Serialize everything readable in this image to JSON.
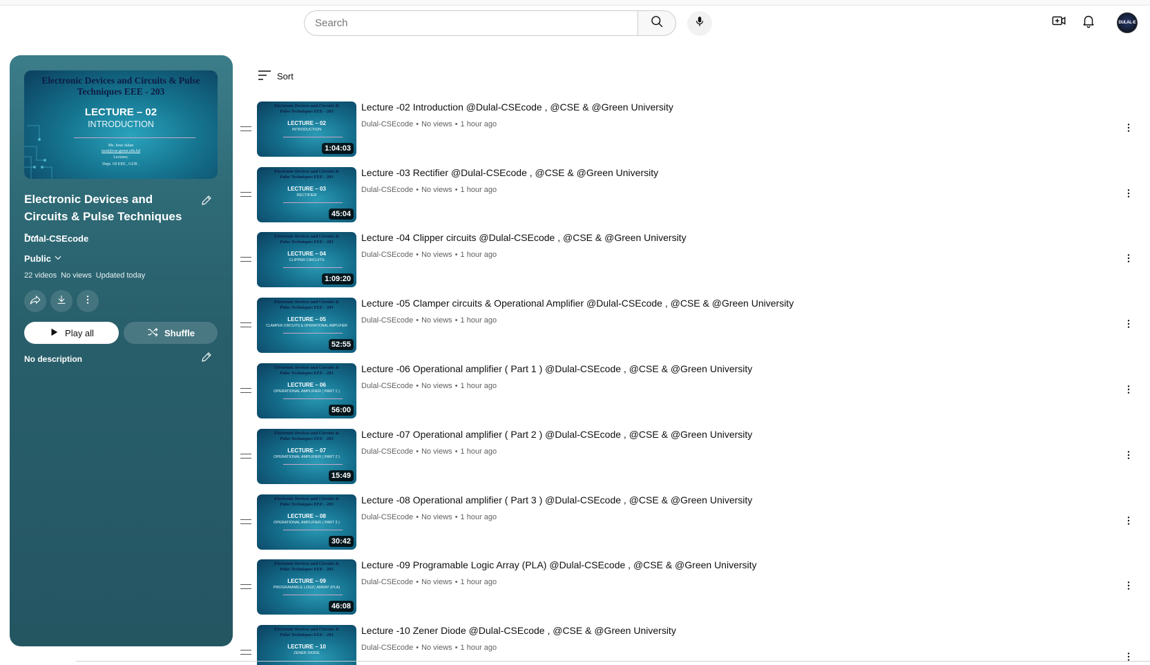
{
  "header": {
    "search_placeholder": "Search",
    "avatar_text": "DULAL-E"
  },
  "playlist": {
    "thumb": {
      "title": "Electronic Devices and Circuits & Pulse Techniques EEE - 203",
      "lecture": "LECTURE – 02",
      "subtitle": "INTRODUCTION",
      "name": "Ms. Israt Jahan",
      "email": "israt@cse.green.edu.bd",
      "role": "Lecturer,",
      "dept": "Dept. Of EEE , GUB ."
    },
    "title": "Electronic Devices and Circuits & Pulse Techniques -...",
    "owner": "Dulal-CSEcode",
    "privacy": "Public",
    "video_count": "22 videos",
    "views": "No views",
    "updated": "Updated today",
    "play_all_label": "Play all",
    "shuffle_label": "Shuffle",
    "description": "No description"
  },
  "sort_label": "Sort",
  "videos": [
    {
      "title": "Lecture -02 Introduction @Dulal-CSEcode , @CSE & @Green University",
      "channel": "Dulal-CSEcode",
      "views": "No views",
      "age": "1 hour ago",
      "duration": "1:04:03",
      "thumb_lecture": "LECTURE – 02",
      "thumb_sub": "INTRODUCTION"
    },
    {
      "title": "Lecture -03 Rectifier @Dulal-CSEcode , @CSE & @Green University",
      "channel": "Dulal-CSEcode",
      "views": "No views",
      "age": "1 hour ago",
      "duration": "45:04",
      "thumb_lecture": "LECTURE – 03",
      "thumb_sub": "RECTIFIER"
    },
    {
      "title": "Lecture -04 Clipper circuits @Dulal-CSEcode , @CSE & @Green University",
      "channel": "Dulal-CSEcode",
      "views": "No views",
      "age": "1 hour ago",
      "duration": "1:09:20",
      "thumb_lecture": "LECTURE – 04",
      "thumb_sub": "CLIPPER CIRCUITS"
    },
    {
      "title": "Lecture -05 Clamper circuits & Operational Amplifier @Dulal-CSEcode , @CSE & @Green University",
      "channel": "Dulal-CSEcode",
      "views": "No views",
      "age": "1 hour ago",
      "duration": "52:55",
      "thumb_lecture": "LECTURE – 05",
      "thumb_sub": "CLAMPER CIRCUITS & OPERATIONAL AMPLIFIER"
    },
    {
      "title": "Lecture -06 Operational amplifier ( Part 1 ) @Dulal-CSEcode , @CSE & @Green University",
      "channel": "Dulal-CSEcode",
      "views": "No views",
      "age": "1 hour ago",
      "duration": "56:00",
      "thumb_lecture": "LECTURE – 06",
      "thumb_sub": "OPERATIONAL AMPLIFIER ( PART 1 )"
    },
    {
      "title": "Lecture -07 Operational amplifier ( Part 2 ) @Dulal-CSEcode , @CSE & @Green University",
      "channel": "Dulal-CSEcode",
      "views": "No views",
      "age": "1 hour ago",
      "duration": "15:49",
      "thumb_lecture": "LECTURE – 07",
      "thumb_sub": "OPERATIONAL AMPLIFIER ( PART 2 )"
    },
    {
      "title": "Lecture -08 Operational amplifier ( Part 3 ) @Dulal-CSEcode , @CSE & @Green University",
      "channel": "Dulal-CSEcode",
      "views": "No views",
      "age": "1 hour ago",
      "duration": "30:42",
      "thumb_lecture": "LECTURE – 08",
      "thumb_sub": "OPERATIONAL AMPLIFIER ( PART 3 )"
    },
    {
      "title": "Lecture -09 Programable Logic Array (PLA) @Dulal-CSEcode , @CSE & @Green University",
      "channel": "Dulal-CSEcode",
      "views": "No views",
      "age": "1 hour ago",
      "duration": "46:08",
      "thumb_lecture": "LECTURE – 09",
      "thumb_sub": "PROGRAMABLE LOGIC ARRAY (PLA)"
    },
    {
      "title": "Lecture -10 Zener Diode @Dulal-CSEcode , @CSE & @Green University",
      "channel": "Dulal-CSEcode",
      "views": "No views",
      "age": "1 hour ago",
      "duration": "",
      "thumb_lecture": "LECTURE – 10",
      "thumb_sub": "ZENER DIODE"
    }
  ],
  "thumb_common": {
    "title_line1": "Electronic Devices and Circuits &",
    "title_line2": "Pulse Techniques EEE - 203"
  },
  "colors": {
    "panel_top": "#3c7d8a",
    "panel_bottom": "#245662",
    "thumb_bg": "#146e8c"
  }
}
